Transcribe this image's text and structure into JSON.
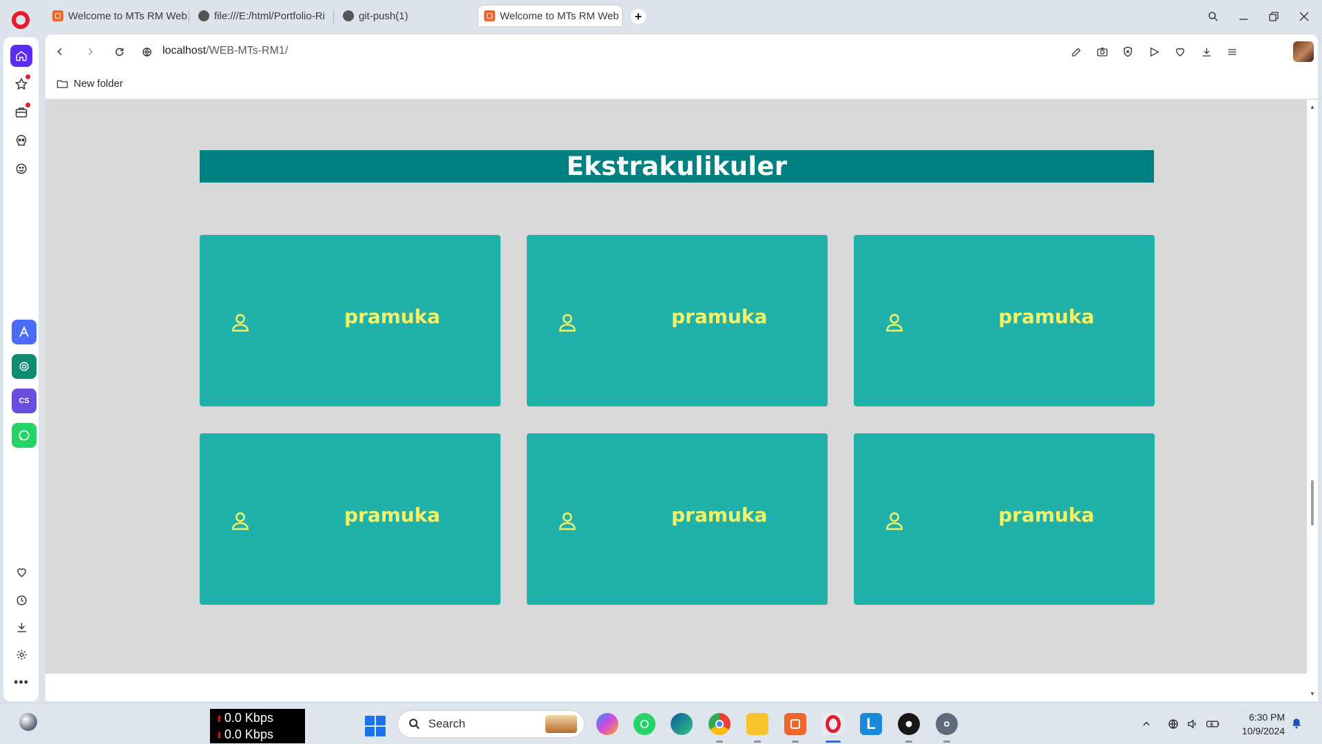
{
  "browser": {
    "tabs": [
      {
        "title": "Welcome to MTs RM Web",
        "favicon": "xampp-icon",
        "active": false
      },
      {
        "title": "file:///E:/html/Portfolio-Ri",
        "favicon": "globe-icon",
        "active": false
      },
      {
        "title": "git-push(1)",
        "favicon": "globe-icon",
        "active": false
      },
      {
        "title": "Welcome to MTs RM Web",
        "favicon": "xampp-icon",
        "active": true
      }
    ],
    "address": {
      "host": "localhost",
      "path": "/WEB-MTs-RM1/"
    },
    "bookmarks": [
      {
        "label": "New folder",
        "icon": "folder-icon"
      }
    ]
  },
  "page": {
    "section_title": "Ekstrakulikuler",
    "cards": [
      {
        "label": "pramuka",
        "icon": "user-icon"
      },
      {
        "label": "pramuka",
        "icon": "user-icon"
      },
      {
        "label": "pramuka",
        "icon": "user-icon"
      },
      {
        "label": "pramuka",
        "icon": "user-icon"
      },
      {
        "label": "pramuka",
        "icon": "user-icon"
      },
      {
        "label": "pramuka",
        "icon": "user-icon"
      }
    ],
    "colors": {
      "title_bg": "#008080",
      "card_bg": "#20b2aa",
      "card_text": "#f2f268",
      "page_bg": "#d9d9d9"
    }
  },
  "taskbar": {
    "net_up": "0.0 Kbps",
    "net_down": "0.0 Kbps",
    "search_placeholder": "Search",
    "time": "6:30 PM",
    "date": "10/9/2024"
  }
}
